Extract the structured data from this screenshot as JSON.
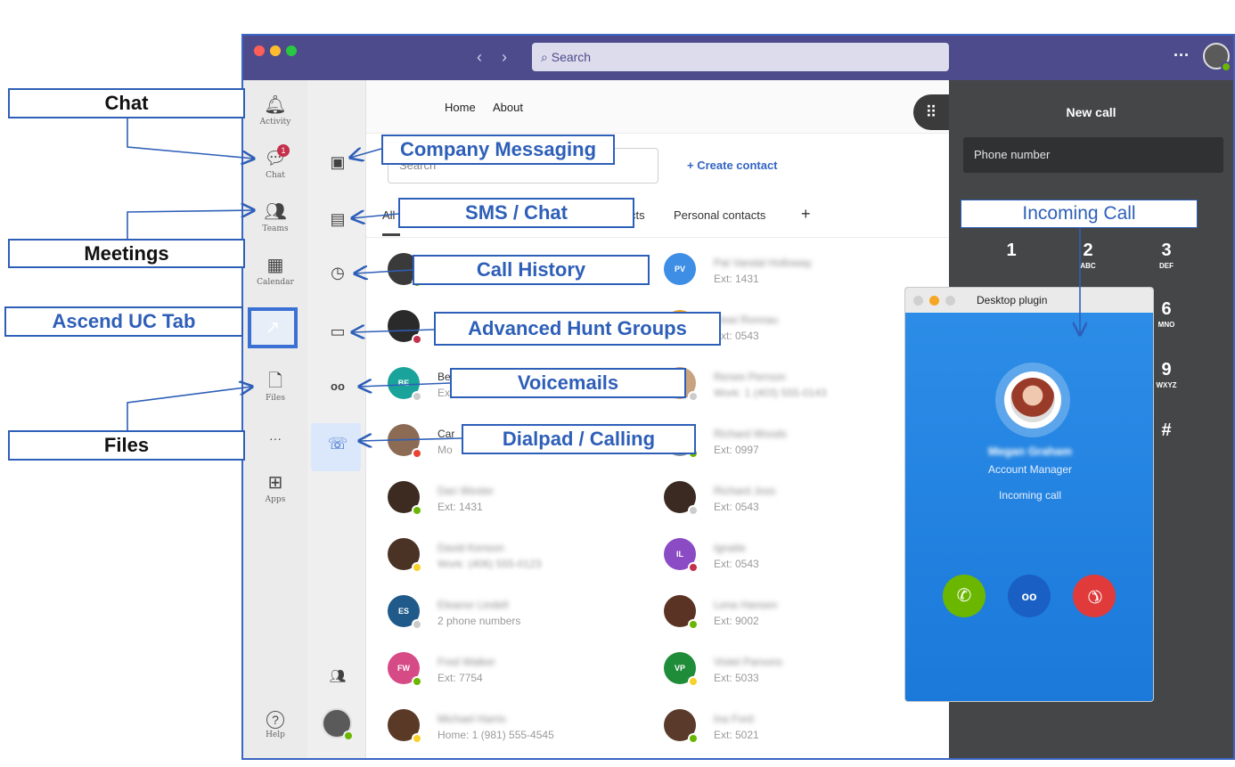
{
  "titlebar": {
    "search_placeholder": "Search",
    "more": "···",
    "nav_back": "‹",
    "nav_forward": "›",
    "search_icon": "⌕"
  },
  "rail": {
    "items": [
      {
        "label": "Activity",
        "icon": "bell-icon",
        "glyph": "🔔︎"
      },
      {
        "label": "Chat",
        "icon": "chat-icon",
        "glyph": "💬︎",
        "badge": "1"
      },
      {
        "label": "Teams",
        "icon": "teams-icon",
        "glyph": "👥︎"
      },
      {
        "label": "Calendar",
        "icon": "calendar-icon",
        "glyph": "▦"
      },
      {
        "label": "Files",
        "icon": "files-icon",
        "glyph": "🗋"
      },
      {
        "label": "",
        "icon": "more-icon",
        "glyph": "···"
      },
      {
        "label": "Apps",
        "icon": "apps-icon",
        "glyph": "⊞"
      },
      {
        "label": "Help",
        "icon": "help-icon",
        "glyph": "?"
      }
    ]
  },
  "header": {
    "tab_home": "Home",
    "tab_about": "About",
    "grid_glyph": "⠿"
  },
  "toolbar": {
    "search_placeholder": "Search",
    "create_contact": "+ Create contact"
  },
  "subtabs": {
    "all": "All",
    "contacts": "cts",
    "personal": "Personal contacts",
    "add": "+"
  },
  "contacts_left": [
    {
      "name": "",
      "sub": "",
      "initials": "",
      "color": "#3a3a3a",
      "status": "#6bb700"
    },
    {
      "name": "",
      "sub": "",
      "initials": "",
      "color": "#2a2a2a",
      "status": "#c4314b"
    },
    {
      "name": "Be",
      "sub": "Ex",
      "initials": "BE",
      "color": "#1aa39a",
      "status": "#cccccc"
    },
    {
      "name": "Car",
      "sub": "Mo",
      "initials": "",
      "color": "#8c6b55",
      "status": "#ea4335"
    },
    {
      "name": "Dan Wester",
      "sub": "Ext: 1431",
      "initials": "",
      "color": "#3d2b22",
      "status": "#6bb700"
    },
    {
      "name": "David Kenson",
      "sub": "Work: (406) 555-0123",
      "initials": "",
      "color": "#4a3325",
      "status": "#f8d22a"
    },
    {
      "name": "Eleanor Lindell",
      "sub": "2 phone numbers",
      "initials": "ES",
      "color": "#1f5a8a",
      "status": "#cccccc"
    },
    {
      "name": "Fred Walker",
      "sub": "Ext: 7754",
      "initials": "FW",
      "color": "#d64a86",
      "status": "#6bb700"
    },
    {
      "name": "Michael Harris",
      "sub": "Home: 1 (981) 555-4545",
      "initials": "",
      "color": "#5a3a26",
      "status": "#f8d22a"
    }
  ],
  "contacts_right": [
    {
      "name": "Pat Vandal Holloway",
      "sub": "Ext: 1431",
      "initials": "PV",
      "color": "#3d8ee4",
      "status": ""
    },
    {
      "name": "Rewi Ronnau",
      "sub": "Ext: 0543",
      "initials": "",
      "color": "#f0a020",
      "status": ""
    },
    {
      "name": "Renee Perrson",
      "sub": "Work: 1 (403) 555-0143",
      "initials": "",
      "color": "#c9a27f",
      "status": "#cccccc"
    },
    {
      "name": "Richard Woods",
      "sub": "Ext: 0997",
      "initials": "",
      "color": "#7f8fa0",
      "status": "#6bb700"
    },
    {
      "name": "Richard Joss",
      "sub": "Ext: 0543",
      "initials": "",
      "color": "#3a2a22",
      "status": "#cccccc"
    },
    {
      "name": "Ignatie",
      "sub": "Ext: 0543",
      "initials": "IL",
      "color": "#8a4bc4",
      "status": "#c4314b"
    },
    {
      "name": "Lena Hansen",
      "sub": "Ext: 9002",
      "initials": "",
      "color": "#5a3324",
      "status": "#6bb700"
    },
    {
      "name": "Violet Parsons",
      "sub": "Ext: 5033",
      "initials": "VP",
      "color": "#1f8c3a",
      "status": "#f8d22a"
    },
    {
      "name": "Ina Ford",
      "sub": "Ext: 5021",
      "initials": "",
      "color": "#5a3a2a",
      "status": "#6bb700"
    }
  ],
  "dialer": {
    "title": "New call",
    "phone_placeholder": "Phone number",
    "keys": [
      {
        "n": "1",
        "l": ""
      },
      {
        "n": "2",
        "l": "ABC"
      },
      {
        "n": "3",
        "l": "DEF"
      },
      {
        "n": "6",
        "l": "MNO"
      },
      {
        "n": "9",
        "l": "WXYZ"
      },
      {
        "n": "#",
        "l": ""
      }
    ]
  },
  "plugin": {
    "title": "Desktop plugin",
    "caller_name": "Megan Graham",
    "caller_role": "Account Manager",
    "status": "Incoming call",
    "accept_glyph": "✆",
    "voicemail_glyph": "oo",
    "decline_glyph": "✆"
  },
  "app_icons": {
    "company_glyph": "▣",
    "sms_glyph": "▤",
    "history_glyph": "◷",
    "hunt_glyph": "▭",
    "voicemail_glyph": "oo",
    "dialpad_glyph": "☏",
    "people_glyph": "👥︎"
  },
  "annotations": {
    "chat": "Chat",
    "meetings": "Meetings",
    "ascend": "Ascend UC Tab",
    "files": "Files",
    "company": "Company Messaging",
    "sms": "SMS / Chat",
    "history": "Call History",
    "hunt": "Advanced Hunt Groups",
    "voicemails": "Voicemails",
    "dialpad": "Dialpad / Calling",
    "incoming": "Incoming Call"
  },
  "colors": {
    "titlebar": "#4d4b8c",
    "accent": "#3464c4",
    "annotation": "#2e5fb8",
    "accept": "#6bb700",
    "decline": "#e03a3a",
    "voicemail": "#1a5fc4"
  }
}
